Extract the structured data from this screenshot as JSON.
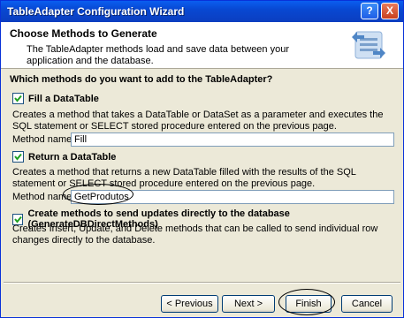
{
  "window": {
    "title": "TableAdapter Configuration Wizard",
    "help": "?",
    "close": "X"
  },
  "header": {
    "heading": "Choose Methods to Generate",
    "description": "The TableAdapter methods load and save data between your application and the database."
  },
  "question": "Which methods do you want to add to the TableAdapter?",
  "fill": {
    "checked": true,
    "label": "Fill a DataTable",
    "description": "Creates a method that takes a DataTable or DataSet as a parameter and executes the SQL statement or SELECT stored procedure entered on the previous page.",
    "method_label": "Method name:",
    "method_value": "Fill"
  },
  "return": {
    "checked": true,
    "label": "Return a DataTable",
    "description": "Creates a method that returns a new DataTable filled with the results of the SQL statement or SELECT stored procedure entered on the previous page.",
    "method_label": "Method name:",
    "method_value": "GetProdutos"
  },
  "direct": {
    "checked": true,
    "label": "Create methods to send updates directly to the database (GenerateDBDirectMethods)",
    "description": "Creates Insert, Update, and Delete methods that can be called to send individual row changes directly to the database."
  },
  "buttons": {
    "previous": "< Previous",
    "next": "Next >",
    "finish": "Finish",
    "cancel": "Cancel"
  },
  "colors": {
    "title_bar": "#0848d2",
    "dialog_bg": "#ece9d8",
    "check": "#21a121"
  }
}
